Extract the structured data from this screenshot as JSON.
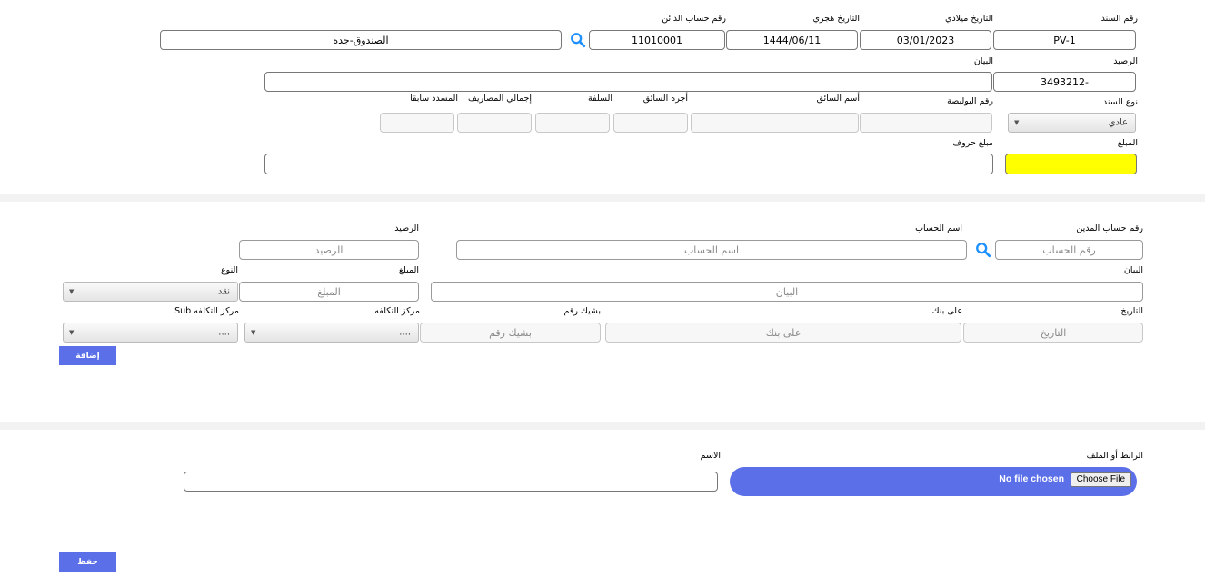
{
  "header": {
    "voucher_no": {
      "label": "رقم السند",
      "value": "PV-1"
    },
    "gregorian_date": {
      "label": "التاريخ ميلادي",
      "value": "03/01/2023"
    },
    "hijri_date": {
      "label": "التاريخ هجري",
      "value": "1444/06/11"
    },
    "creditor_account_no": {
      "label": "رقم حساب الدائن",
      "value": "11010001"
    },
    "creditor_account_name": {
      "value": "الصندوق-جده"
    },
    "balance": {
      "label": "الرصيد",
      "value": "3493212-"
    },
    "statement": {
      "label": "البيان",
      "value": ""
    },
    "voucher_type": {
      "label": "نوع السند",
      "value": "عادي"
    },
    "policy_no": {
      "label": "رقم البوليصة"
    },
    "driver_name": {
      "label": "أسم السائق"
    },
    "driver_fee": {
      "label": "أجره السائق"
    },
    "advance": {
      "label": "السلفة"
    },
    "total_expenses": {
      "label": "إجمالي المصاريف"
    },
    "previously_paid": {
      "label": "المسدد سابقا"
    },
    "amount": {
      "label": "المبلغ",
      "value": "",
      "highlight": "#ffff00"
    },
    "amount_words": {
      "label": "مبلغ حروف",
      "value": ""
    }
  },
  "detail": {
    "debtor_account_no": {
      "label": "رقم حساب المدين",
      "placeholder": "رقم الحساب"
    },
    "account_name": {
      "label": "اسم الحساب",
      "placeholder": "اسم الحساب"
    },
    "balance": {
      "label": "الرصيد",
      "placeholder": "الرصيد"
    },
    "statement": {
      "label": "البيان",
      "placeholder": "البيان"
    },
    "amount": {
      "label": "المبلغ",
      "placeholder": "المبلغ"
    },
    "type": {
      "label": "النوع",
      "value": "نقد"
    },
    "date": {
      "label": "التاريخ",
      "placeholder": "التاريخ"
    },
    "on_bank": {
      "label": "على بنك",
      "placeholder": "على بنك"
    },
    "cheque_no": {
      "label": "بشيك رقم",
      "placeholder": "بشيك رقم"
    },
    "cost_center": {
      "label": "مركز التكلفه",
      "value": "...."
    },
    "sub_cost_center": {
      "label": "مركز التكلفه Sub",
      "value": "...."
    },
    "add_button": "إضافة"
  },
  "attachments": {
    "link_or_file": {
      "label": "الرابط أو الملف",
      "choose_button": "Choose File",
      "status": "No file chosen"
    },
    "name": {
      "label": "الاسم",
      "value": ""
    }
  },
  "save_button": "حفظ",
  "colors": {
    "accent": "#5b6fe8",
    "search_icon": "#1e90ff",
    "amount_highlight": "#ffff00"
  },
  "icons": {
    "search": "search-icon",
    "dropdown": "chevron-down-icon"
  }
}
